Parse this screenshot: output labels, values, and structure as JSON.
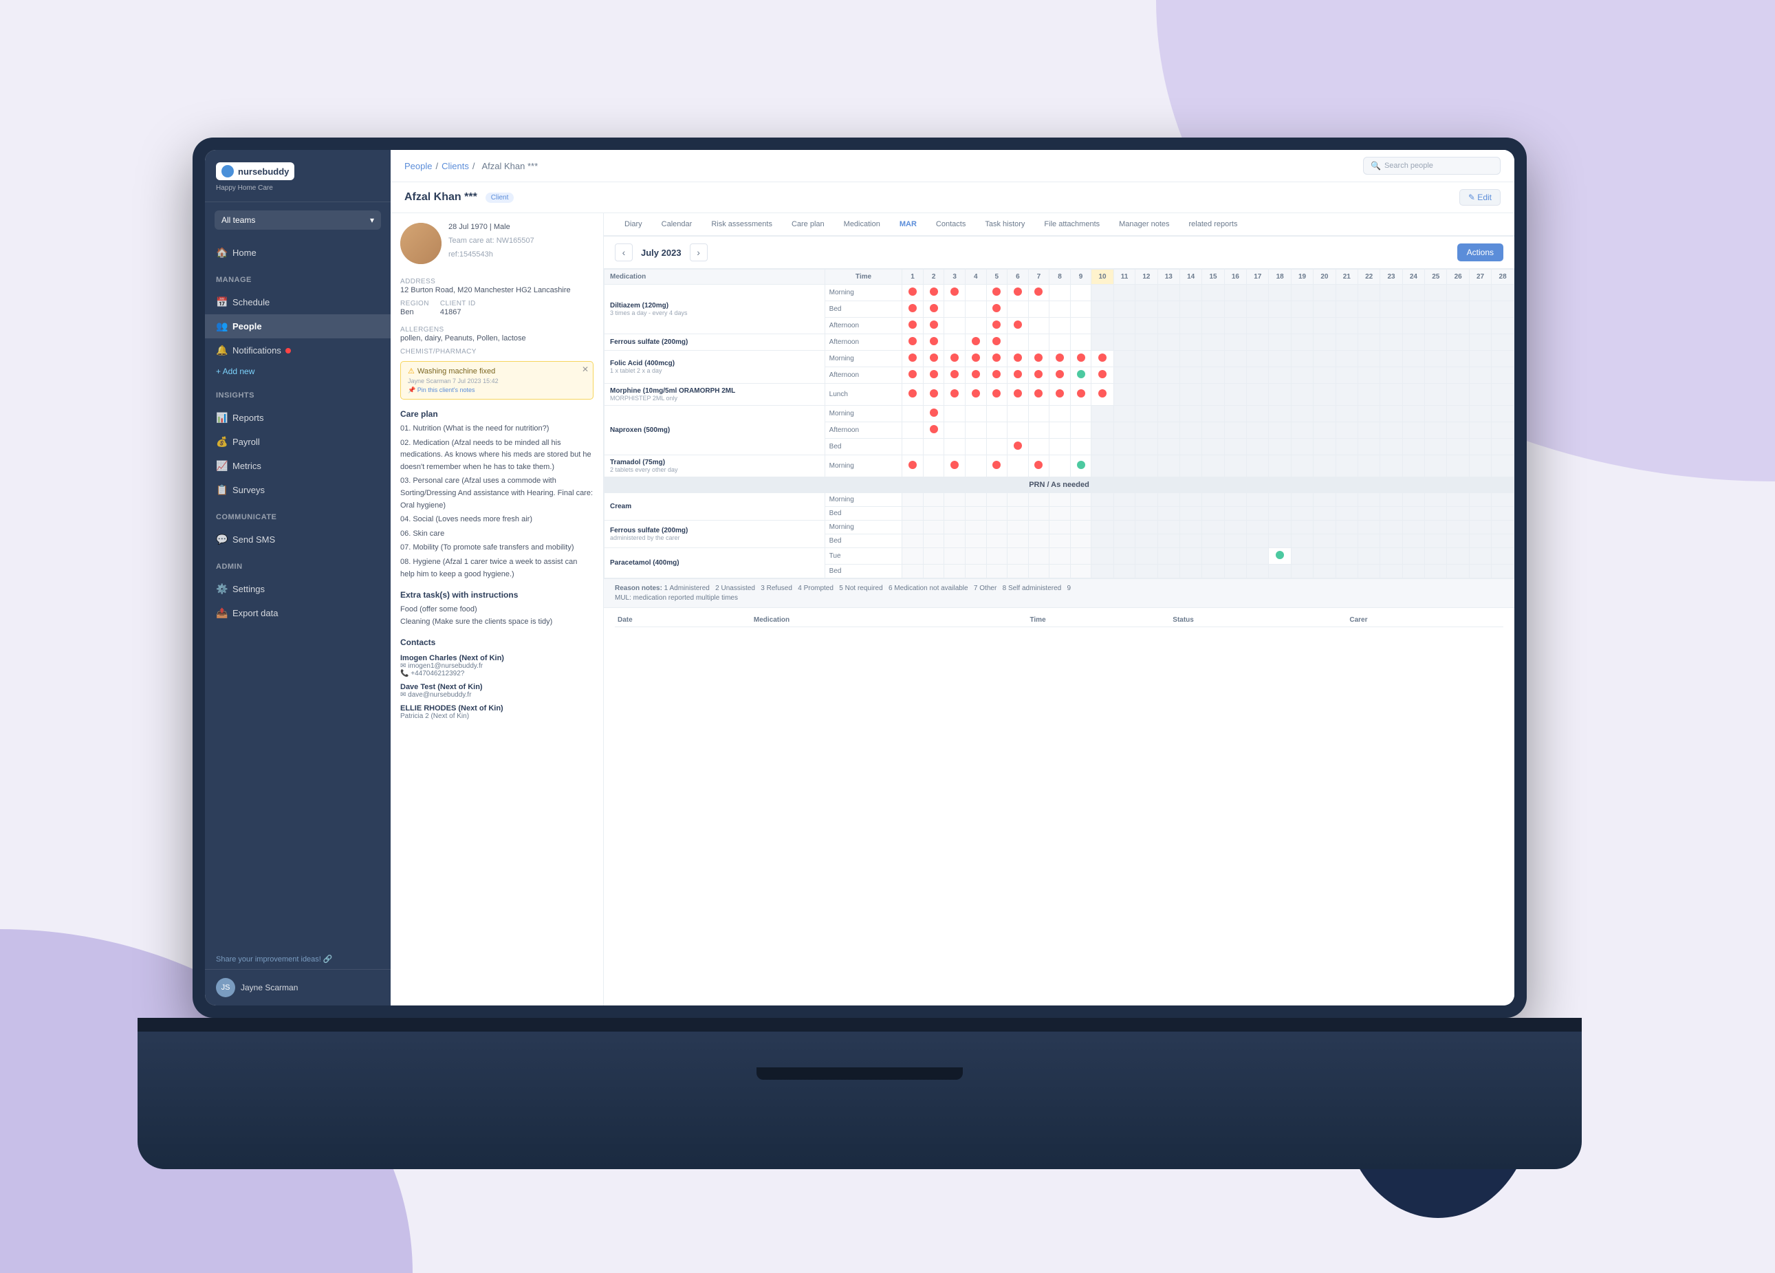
{
  "background": {
    "colors": {
      "main": "#f0eef8",
      "shape1": "#d8d0f0",
      "shape2": "#c8bfe8",
      "dark": "#1a2a4a"
    }
  },
  "app": {
    "name": "nursebuddy",
    "subtitle": "Happy Home Care",
    "search_placeholder": "Search people"
  },
  "sidebar": {
    "team_selector": "All teams",
    "nav_items": [
      {
        "id": "home",
        "label": "Home",
        "icon": "🏠",
        "section": null
      },
      {
        "id": "manage",
        "label": "Manage",
        "icon": null,
        "section": "header"
      },
      {
        "id": "schedule",
        "label": "Schedule",
        "icon": "📅",
        "section": null
      },
      {
        "id": "people",
        "label": "People",
        "icon": "👥",
        "section": null
      },
      {
        "id": "notifications",
        "label": "Notifications",
        "icon": "🔔",
        "section": null,
        "badge": true
      },
      {
        "id": "add-new",
        "label": "+ Add new",
        "icon": null,
        "section": null
      },
      {
        "id": "insights",
        "label": "Insights",
        "icon": null,
        "section": "header"
      },
      {
        "id": "reports",
        "label": "Reports",
        "icon": "📊",
        "section": null
      },
      {
        "id": "payroll",
        "label": "Payroll",
        "icon": "💰",
        "section": null
      },
      {
        "id": "metrics",
        "label": "Metrics",
        "icon": "📈",
        "section": null
      },
      {
        "id": "surveys",
        "label": "Surveys",
        "icon": "📋",
        "section": null
      },
      {
        "id": "communicate",
        "label": "Communicate",
        "icon": null,
        "section": "header"
      },
      {
        "id": "send-sms",
        "label": "Send SMS",
        "icon": "💬",
        "section": null
      },
      {
        "id": "admin",
        "label": "Admin",
        "icon": null,
        "section": "header"
      },
      {
        "id": "settings",
        "label": "Settings",
        "icon": "⚙️",
        "section": null
      },
      {
        "id": "export-data",
        "label": "Export data",
        "icon": "📤",
        "section": null
      }
    ],
    "share_ideas": "Share your improvement ideas! 🔗",
    "user": {
      "name": "Jayne Scarman",
      "initials": "JS"
    }
  },
  "breadcrumb": {
    "items": [
      "People",
      "Clients",
      "Afzal Khan ***"
    ]
  },
  "client": {
    "name": "Afzal Khan ***",
    "tag": "Client",
    "dob": "28 Jul 1970 | Male",
    "nhs": "Team care at: NW165507",
    "id": "ref:1545543h",
    "address": "12 Burton Road, M20 Manchester HG2 Lancashire",
    "region": "Ben",
    "client_id": "41867",
    "allergens": "pollen, dairy, Peanuts, Pollen, lactose",
    "chemist_pharmacy": "",
    "alert": {
      "title": "Washing machine fixed",
      "reporter": "Jayne Scarman 7 Jul 2023 15:42",
      "link": "Pin this client's notes"
    },
    "care_plan": {
      "title": "Care plan",
      "items": [
        "01. Nutrition (What is the need for nutrition?)",
        "02. Medication (Afzal needs to be minded all his medications. As knows where his meds are stored but he doesn't remember when he has to take them.)",
        "03. Personal care (Afzal uses a commode with Sorting/Dressing And assistance with Hearing. Final care: Oral hygiene",
        "04. Social (Loves needs more fresh air)",
        "06. Skin care",
        "07. Mobility (To promote safe transfers and mobility)",
        "08. Hygiene (Afzal 1 carer twice a week to assist can help him to keep a good hygiene.)"
      ]
    },
    "extra_tasks": {
      "title": "Extra task(s) with instructions",
      "items": [
        "Food (offer some food)",
        "Cleaning (Make sure the clients space is tidy)"
      ]
    },
    "contacts": {
      "title": "Contacts",
      "items": [
        {
          "name": "Imogen Charles (Next of Kin)",
          "email": "imogen1@nursebuddy.fr",
          "phone": "+447046212392?",
          "role": "Next of Kin"
        },
        {
          "name": "Dave Test (Next of Kin)",
          "email": "dave@nursebuddy.fr",
          "role": "Next of Kin"
        },
        {
          "name": "ELLIE RHODES (Next of Kin)",
          "email": "PatrIcia 2 (Next of Kin)"
        }
      ]
    }
  },
  "tabs": [
    {
      "id": "diary",
      "label": "Diary",
      "active": false
    },
    {
      "id": "calendar",
      "label": "Calendar",
      "active": false
    },
    {
      "id": "risk-assessments",
      "label": "Risk assessments",
      "active": false
    },
    {
      "id": "care-plan",
      "label": "Care plan",
      "active": false
    },
    {
      "id": "medication",
      "label": "Medication",
      "active": false
    },
    {
      "id": "mar",
      "label": "MAR",
      "active": true
    },
    {
      "id": "contacts",
      "label": "Contacts",
      "active": false
    },
    {
      "id": "task-history",
      "label": "Task history",
      "active": false
    },
    {
      "id": "file-attachments",
      "label": "File attachments",
      "active": false
    },
    {
      "id": "manager-notes",
      "label": "Manager notes",
      "active": false
    },
    {
      "id": "related-reports",
      "label": "related reports",
      "active": false
    }
  ],
  "mar": {
    "month": "July 2023",
    "actions_label": "Actions",
    "columns": {
      "medication_header": "Medication",
      "time_header": "Time",
      "days": [
        "1",
        "2",
        "3",
        "4",
        "5",
        "6",
        "7",
        "8",
        "9",
        "10",
        "11",
        "12",
        "13",
        "14",
        "15",
        "16",
        "17",
        "18",
        "19",
        "20",
        "21",
        "22",
        "23",
        "24",
        "25",
        "26",
        "27",
        "28"
      ]
    },
    "medications": [
      {
        "name": "Diltiazem (120mg)",
        "sub": "3 times a day - every 4 days",
        "times": [
          {
            "label": "Morning",
            "dots": [
              1,
              1,
              1,
              0,
              1,
              1,
              1,
              0,
              0,
              0,
              0,
              0,
              0,
              0,
              0,
              0,
              0,
              0,
              0,
              0,
              0,
              0,
              0,
              0,
              0,
              0,
              0,
              0
            ]
          },
          {
            "label": "Bed",
            "dots": [
              1,
              1,
              0,
              0,
              1,
              0,
              0,
              0,
              0,
              0,
              0,
              0,
              0,
              0,
              0,
              0,
              0,
              0,
              0,
              0,
              0,
              0,
              0,
              0,
              0,
              0,
              0,
              0
            ]
          },
          {
            "label": "Afternoon",
            "dots": [
              1,
              1,
              0,
              0,
              1,
              1,
              0,
              0,
              0,
              0,
              0,
              0,
              0,
              0,
              0,
              0,
              0,
              0,
              0,
              0,
              0,
              0,
              0,
              0,
              0,
              0,
              0,
              0
            ]
          }
        ]
      },
      {
        "name": "Ferrous sulfate (200mg)",
        "times": [
          {
            "label": "Afternoon",
            "dots": [
              1,
              1,
              0,
              1,
              1,
              0,
              0,
              0,
              0,
              0,
              0,
              0,
              0,
              0,
              0,
              0,
              0,
              0,
              0,
              0,
              0,
              0,
              0,
              0,
              0,
              0,
              0,
              0
            ]
          }
        ]
      },
      {
        "name": "Folic Acid (400mcg)",
        "sub": "1 x tablet 2 x a day",
        "times": [
          {
            "label": "Morning",
            "dots": [
              1,
              1,
              1,
              1,
              1,
              1,
              1,
              1,
              1,
              1,
              0,
              0,
              0,
              0,
              0,
              0,
              0,
              0,
              0,
              0,
              0,
              0,
              0,
              0,
              0,
              0,
              0,
              0
            ]
          },
          {
            "label": "Afternoon",
            "dots": [
              1,
              1,
              1,
              1,
              1,
              1,
              1,
              1,
              2,
              1,
              0,
              0,
              0,
              0,
              0,
              0,
              0,
              0,
              0,
              0,
              0,
              0,
              0,
              0,
              0,
              0,
              0,
              0
            ]
          }
        ]
      },
      {
        "name": "Morphine (10mg/5ml ORAMORPH 2ML",
        "sub": "MORPHISTEP 2ML only",
        "times": [
          {
            "label": "Lunch",
            "dots": [
              1,
              1,
              1,
              1,
              1,
              1,
              1,
              1,
              1,
              1,
              0,
              0,
              0,
              0,
              0,
              0,
              0,
              0,
              0,
              0,
              0,
              0,
              0,
              0,
              0,
              0,
              0,
              0
            ]
          }
        ]
      },
      {
        "name": "Naproxen (500mg)",
        "times": [
          {
            "label": "Morning",
            "dots": [
              0,
              1,
              0,
              0,
              0,
              0,
              0,
              0,
              0,
              0,
              0,
              0,
              0,
              0,
              0,
              0,
              0,
              0,
              0,
              0,
              0,
              0,
              0,
              0,
              0,
              0,
              0,
              0
            ]
          },
          {
            "label": "Afternoon",
            "dots": [
              0,
              1,
              0,
              0,
              0,
              0,
              0,
              0,
              0,
              0,
              0,
              0,
              0,
              0,
              0,
              0,
              0,
              0,
              0,
              0,
              0,
              0,
              0,
              0,
              0,
              0,
              0,
              0
            ]
          },
          {
            "label": "Bed",
            "dots": [
              0,
              0,
              0,
              0,
              0,
              1,
              0,
              0,
              0,
              0,
              0,
              0,
              0,
              0,
              0,
              0,
              0,
              0,
              0,
              0,
              0,
              0,
              0,
              0,
              0,
              0,
              0,
              0
            ]
          }
        ]
      },
      {
        "name": "Tramadol (75mg)",
        "sub": "2 tablets every other day",
        "times": [
          {
            "label": "Morning",
            "dots": [
              1,
              0,
              1,
              0,
              1,
              0,
              1,
              0,
              0,
              0,
              0,
              0,
              0,
              0,
              0,
              0,
              0,
              0,
              0,
              0,
              0,
              0,
              0,
              0,
              0,
              0,
              0,
              0
            ]
          }
        ]
      },
      {
        "name": "PRN / As needed",
        "is_section": true
      },
      {
        "name": "Cream",
        "times": [
          {
            "label": "Morning",
            "dots": [
              0,
              0,
              0,
              0,
              0,
              0,
              0,
              0,
              0,
              0,
              0,
              0,
              0,
              0,
              0,
              0,
              0,
              0,
              0,
              0,
              0,
              0,
              0,
              0,
              0,
              0,
              0,
              0
            ]
          },
          {
            "label": "Bed",
            "dots": [
              0,
              0,
              0,
              0,
              0,
              0,
              0,
              0,
              0,
              0,
              0,
              0,
              0,
              0,
              0,
              0,
              0,
              0,
              0,
              0,
              0,
              0,
              0,
              0,
              0,
              0,
              0,
              0
            ]
          }
        ]
      },
      {
        "name": "Ferrous sulfate (200mg)",
        "sub": "administered by the carer",
        "times": [
          {
            "label": "Morning",
            "dots": [
              0,
              0,
              0,
              0,
              0,
              0,
              0,
              0,
              0,
              0,
              0,
              0,
              0,
              0,
              0,
              0,
              0,
              0,
              0,
              0,
              0,
              0,
              0,
              0,
              0,
              0,
              0,
              0
            ]
          },
          {
            "label": "Bed",
            "dots": [
              0,
              0,
              0,
              0,
              0,
              0,
              0,
              0,
              0,
              0,
              0,
              0,
              0,
              0,
              0,
              0,
              0,
              0,
              0,
              0,
              0,
              0,
              0,
              0,
              0,
              0,
              0,
              0
            ]
          }
        ]
      },
      {
        "name": "Paracetamol (400mg)",
        "times": [
          {
            "label": "Tue",
            "dots": [
              0,
              0,
              0,
              0,
              0,
              0,
              0,
              0,
              0,
              0,
              0,
              0,
              0,
              0,
              0,
              0,
              0,
              2,
              0,
              0,
              0,
              0,
              0,
              0,
              0,
              0,
              0,
              0
            ]
          },
          {
            "label": "Bed",
            "dots": [
              0,
              0,
              0,
              0,
              0,
              0,
              0,
              0,
              0,
              0,
              0,
              0,
              0,
              0,
              0,
              0,
              0,
              0,
              0,
              0,
              0,
              0,
              0,
              0,
              0,
              0,
              0,
              0
            ]
          }
        ]
      }
    ],
    "legend": {
      "items": [
        {
          "color": "#ff5a5a",
          "label": "1 - Administered"
        },
        {
          "color": "#999",
          "label": "2 - Unassisted"
        },
        {
          "color": "#aaa",
          "label": "3 - Refused"
        },
        {
          "color": "#4cc9a0",
          "label": "4 - Prompted"
        },
        {
          "color": "#d0d8e4",
          "label": "5 - Not required"
        },
        {
          "color": "#c8a0c8",
          "label": "6 - Medication not available"
        },
        {
          "color": "#888",
          "label": "7 - Other"
        },
        {
          "color": "#ff8c69",
          "label": "8 - Self administered"
        },
        {
          "color": "#f5a",
          "label": "9 - Medication reported multiple times"
        }
      ],
      "note": "MUL: medication reported multiple times"
    }
  }
}
